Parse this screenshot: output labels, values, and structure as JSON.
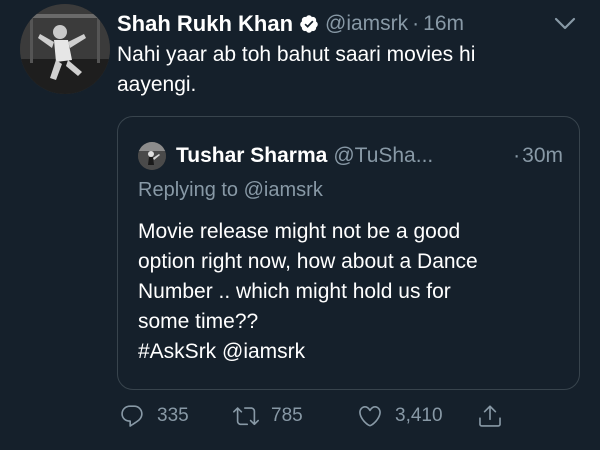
{
  "tweet": {
    "author": {
      "display_name": "Shah Rukh Khan",
      "handle": "@iamsrk",
      "separator": "·",
      "timestamp": "16m",
      "verified": true,
      "avatar_icon": "profile-photo"
    },
    "text": "Nahi yaar ab toh bahut saari movies hi aayengi.",
    "more_icon": "more-options-icon",
    "quoted_tweet": {
      "display_name": "Tushar Sharma",
      "handle": "@TuSha...",
      "separator": "·",
      "timestamp": "30m",
      "replying_to_label": "Replying to",
      "replying_to_handle": "@iamsrk",
      "text_lines": [
        "Movie release might not be a good",
        "option right now, how about a Dance",
        "Number .. which might hold us for",
        "some time??",
        "#AskSrk @iamsrk"
      ]
    },
    "actions": {
      "reply_count": "335",
      "retweet_count": "785",
      "like_count": "3,410",
      "share_icon": "share-icon"
    }
  },
  "colors": {
    "background": "#15202b",
    "text_primary": "#ffffff",
    "text_secondary": "#8899a6",
    "border": "#38444d",
    "verified_badge": "#ffffff"
  }
}
